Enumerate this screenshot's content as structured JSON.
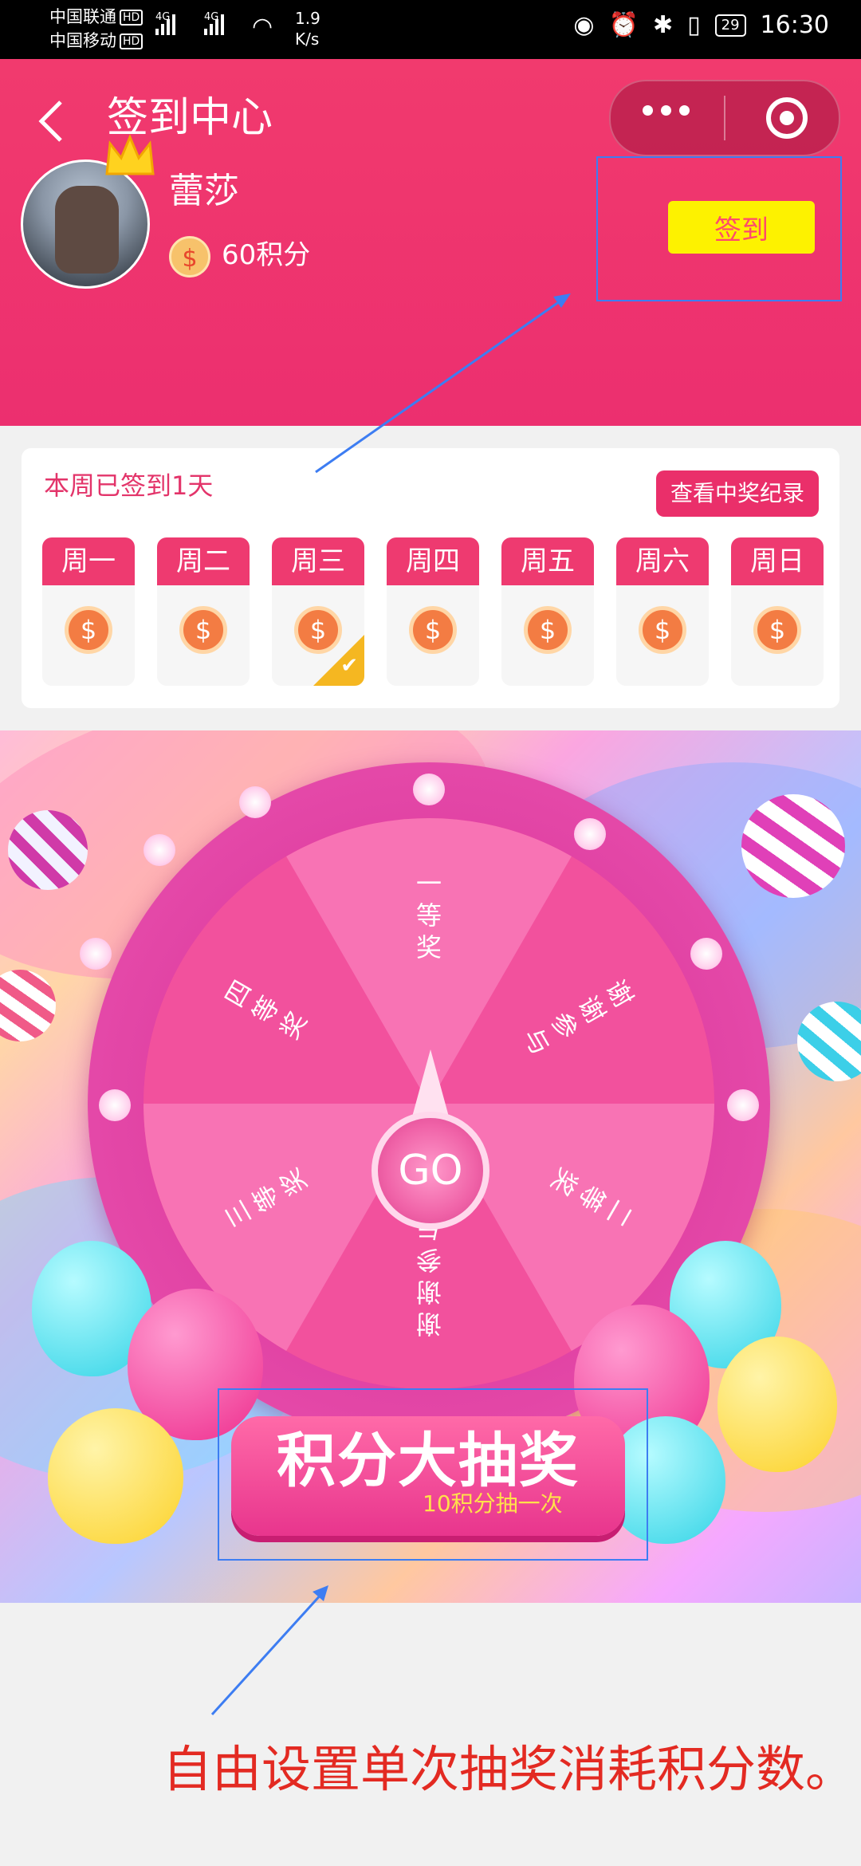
{
  "status_bar": {
    "carrier_1": "中国联通",
    "carrier_2": "中国移动",
    "hd": "HD",
    "net_1": "4G",
    "net_2": "4G",
    "speed_value": "1.9",
    "speed_unit": "K/s",
    "battery": "29",
    "time": "16:30"
  },
  "header": {
    "title": "签到中心",
    "username": "蕾莎",
    "points": "60积分",
    "coin_symbol": "$",
    "signin_label": "签到"
  },
  "week": {
    "status_text": "本周已签到1天",
    "record_button": "查看中奖纪录",
    "days": [
      {
        "label": "周一",
        "checked": false
      },
      {
        "label": "周二",
        "checked": false
      },
      {
        "label": "周三",
        "checked": true
      },
      {
        "label": "周四",
        "checked": false
      },
      {
        "label": "周五",
        "checked": false
      },
      {
        "label": "周六",
        "checked": false
      },
      {
        "label": "周日",
        "checked": false
      }
    ]
  },
  "lottery": {
    "go_label": "GO",
    "prizes": [
      "一等奖",
      "谢谢参与",
      "二等奖",
      "谢谢参与",
      "三等奖",
      "四等奖"
    ],
    "draw_title": "积分大抽奖",
    "draw_subtitle": "10积分抽一次"
  },
  "annotation": {
    "caption": "自由设置单次抽奖消耗积分数。"
  },
  "colors": {
    "header": "#ec2f6f",
    "signin_button": "#fdf200",
    "accent": "#ee3a70",
    "annotation": "#e32a22",
    "frame": "#3d7df2"
  }
}
